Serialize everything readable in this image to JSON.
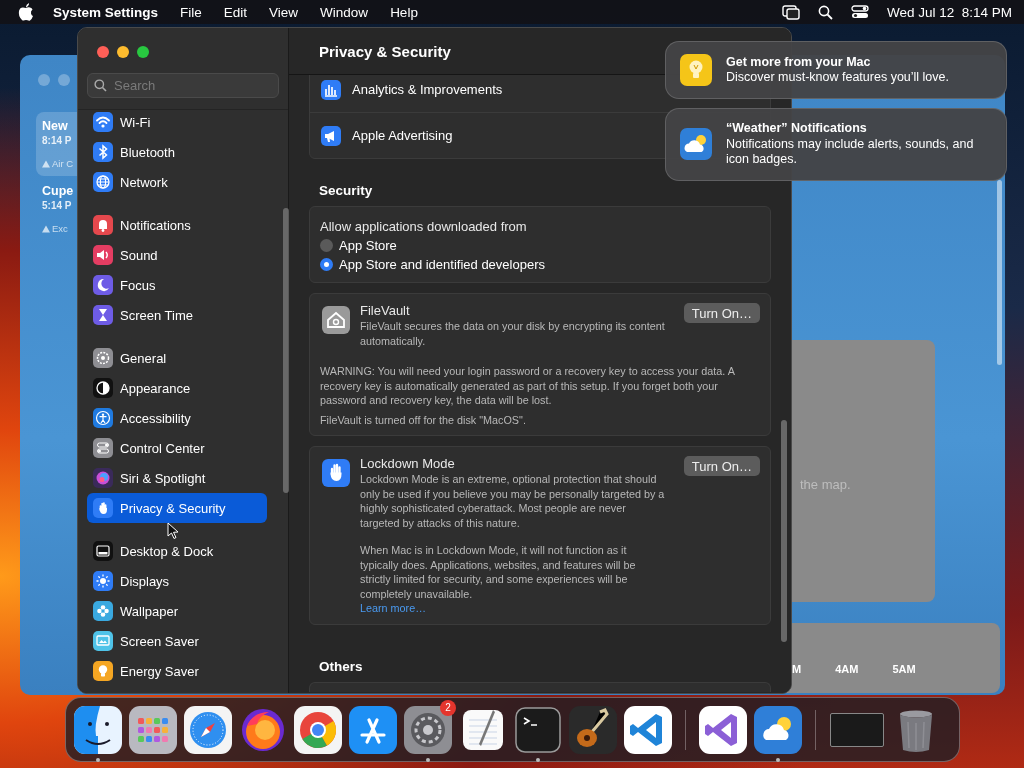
{
  "menu_bar": {
    "app_name": "System Settings",
    "menus": [
      "File",
      "Edit",
      "View",
      "Window",
      "Help"
    ],
    "clock": "Wed Jul 12  8:14 PM"
  },
  "background_window": {
    "locations": [
      {
        "name": "New",
        "time": "8:14 P",
        "note": "Air C",
        "selected": true
      },
      {
        "name": "Cupe",
        "time": "5:14 P",
        "note": "Exc",
        "selected": false
      }
    ],
    "map_caption": "the map.",
    "hours": [
      "M",
      "4AM",
      "5AM"
    ]
  },
  "settings": {
    "title": "Privacy & Security",
    "search": {
      "placeholder": "Search"
    },
    "sidebar": {
      "groups": [
        {
          "items": [
            {
              "label": "Wi-Fi",
              "color": "#2f7cf6",
              "selected": false
            },
            {
              "label": "Bluetooth",
              "color": "#2f7cf6",
              "selected": false
            },
            {
              "label": "Network",
              "color": "#2f7cf6",
              "selected": false
            }
          ]
        },
        {
          "items": [
            {
              "label": "Notifications",
              "color": "#e5484d",
              "selected": false
            },
            {
              "label": "Sound",
              "color": "#e43d62",
              "selected": false
            },
            {
              "label": "Focus",
              "color": "#6e5ce6",
              "selected": false
            },
            {
              "label": "Screen Time",
              "color": "#6e5ce6",
              "selected": false
            }
          ]
        },
        {
          "items": [
            {
              "label": "General",
              "color": "#8e8e93",
              "selected": false
            },
            {
              "label": "Appearance",
              "color": "#111111",
              "selected": false
            },
            {
              "label": "Accessibility",
              "color": "#1f7ae0",
              "selected": false
            },
            {
              "label": "Control Center",
              "color": "#8e8e93",
              "selected": false
            },
            {
              "label": "Siri & Spotlight",
              "color": "#3a2a5a",
              "selected": false
            },
            {
              "label": "Privacy & Security",
              "color": "#2f7cf6",
              "selected": true
            }
          ]
        },
        {
          "items": [
            {
              "label": "Desktop & Dock",
              "color": "#111111",
              "selected": false
            },
            {
              "label": "Displays",
              "color": "#2f7cf6",
              "selected": false
            },
            {
              "label": "Wallpaper",
              "color": "#3aa9e0",
              "selected": false
            },
            {
              "label": "Screen Saver",
              "color": "#4fc3e8",
              "selected": false
            },
            {
              "label": "Energy Saver",
              "color": "#f5a623",
              "selected": false
            }
          ]
        }
      ]
    },
    "sections": [
      {
        "kind": "list_card",
        "rows": [
          {
            "label": "Analytics & Improvements"
          },
          {
            "label": "Apple Advertising"
          }
        ]
      },
      {
        "kind": "heading",
        "text": "Security"
      },
      {
        "kind": "radio_card",
        "prompt": "Allow applications downloaded from",
        "options": [
          {
            "label": "App Store",
            "selected": false
          },
          {
            "label": "App Store and identified developers",
            "selected": true
          }
        ]
      },
      {
        "kind": "feature_card",
        "title": "FileVault",
        "description": "FileVault secures the data on your disk by encrypting its content automatically.",
        "button": "Turn On…",
        "notes": [
          "WARNING: You will need your login password or a recovery key to access your data. A recovery key is automatically generated as part of this setup. If you forget both your password and recovery key, the data will be lost.",
          "FileVault is turned off for the disk \"MacOS\"."
        ]
      },
      {
        "kind": "feature_card",
        "title": "Lockdown Mode",
        "description": "Lockdown Mode is an extreme, optional protection that should only be used if you believe you may be personally targeted by a highly sophisticated cyberattack. Most people are never targeted by attacks of this nature.",
        "details": "When Mac is in Lockdown Mode, it will not function as it typically does. Applications, websites, and features will be strictly limited for security, and some experiences will be completely unavailable.",
        "link": "Learn more…",
        "button": "Turn On…"
      },
      {
        "kind": "heading",
        "text": "Others"
      }
    ]
  },
  "notifications": [
    {
      "title": "Get more from your Mac",
      "body": "Discover must-know features you’ll love."
    },
    {
      "title": "“Weather” Notifications",
      "body": "Notifications may include alerts, sounds, and icon badges."
    }
  ],
  "dock": {
    "items": [
      {
        "kind": "app",
        "running": true
      },
      {
        "kind": "app",
        "running": false
      },
      {
        "kind": "app",
        "running": false
      },
      {
        "kind": "app",
        "running": false
      },
      {
        "kind": "app",
        "running": false
      },
      {
        "kind": "app",
        "running": false
      },
      {
        "kind": "app",
        "running": true,
        "badge": "2"
      },
      {
        "kind": "app",
        "running": false
      },
      {
        "kind": "app",
        "running": true
      },
      {
        "kind": "app",
        "running": false
      },
      {
        "kind": "app",
        "running": false
      },
      {
        "kind": "separator"
      },
      {
        "kind": "app",
        "running": false
      },
      {
        "kind": "app",
        "running": true
      },
      {
        "kind": "separator"
      },
      {
        "kind": "thumbnail"
      },
      {
        "kind": "trash"
      }
    ]
  }
}
